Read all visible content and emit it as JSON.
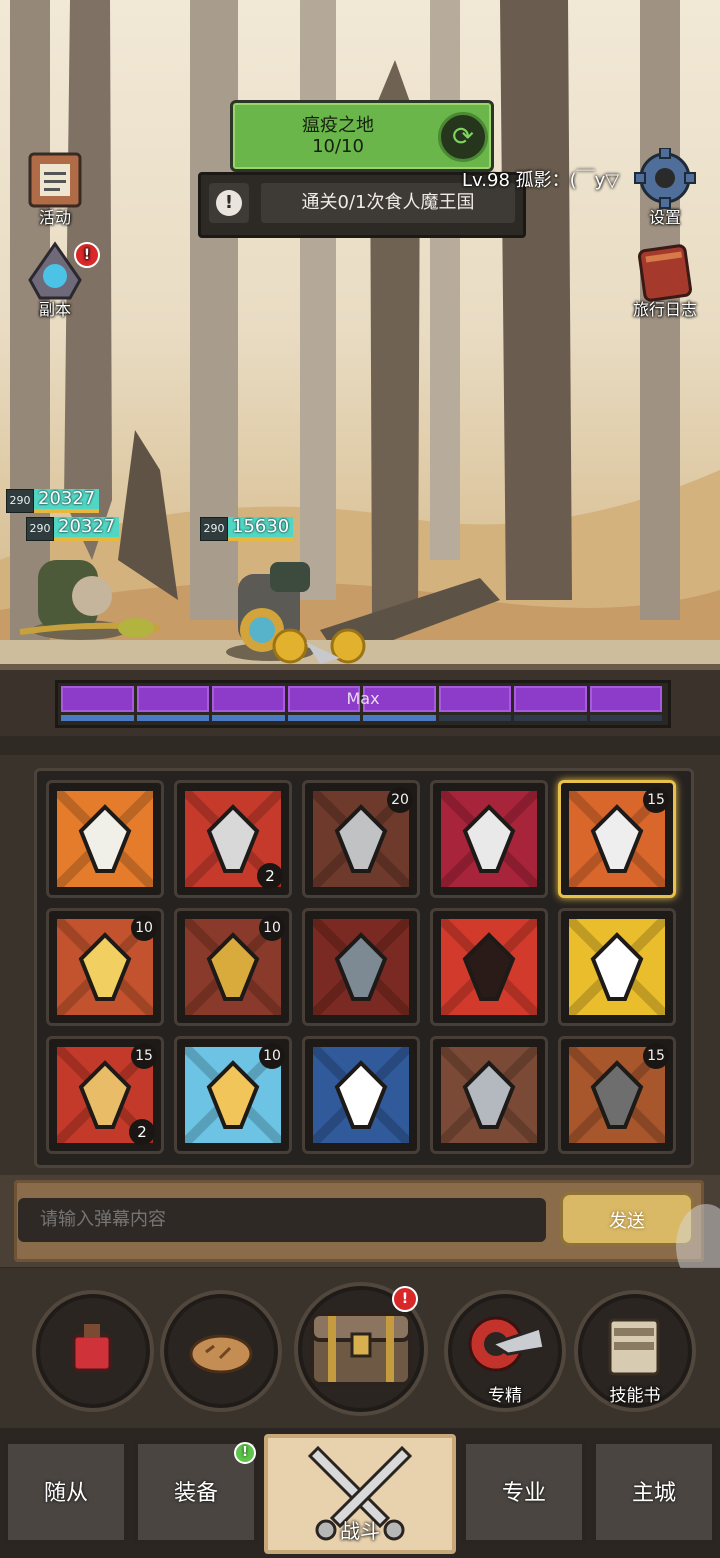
{
  "stage": {
    "name": "瘟疫之地",
    "progress": "10/10"
  },
  "quest": {
    "text": "通关0/1次食人魔王国"
  },
  "player": {
    "info": "Lv.98 孤影：(￣y▽"
  },
  "left_menu": [
    {
      "label": "活动",
      "icon": "event-scroll-icon",
      "alert": false
    },
    {
      "label": "副本",
      "icon": "dungeon-portal-icon",
      "alert": true,
      "alert_mark": "!"
    }
  ],
  "right_menu": [
    {
      "label": "设置",
      "icon": "gear-icon"
    },
    {
      "label": "旅行日志",
      "icon": "journal-icon"
    }
  ],
  "units": [
    {
      "level": "290",
      "hp": "20327"
    },
    {
      "level": "290",
      "hp": "20327"
    },
    {
      "level": "290",
      "hp": "15630"
    }
  ],
  "rage_bar": {
    "label": "Max",
    "segments": 8,
    "fill": 1.0
  },
  "skills": [
    {
      "icon": "white-shield-skill-icon",
      "badge": "",
      "count": ""
    },
    {
      "icon": "blade-slash-skill-icon",
      "badge": "",
      "count": "2"
    },
    {
      "icon": "warrior-helm-skill-icon",
      "badge": "20",
      "count": ""
    },
    {
      "icon": "heavy-cleave-skill-icon",
      "badge": "",
      "count": ""
    },
    {
      "icon": "sword-thrust-skill-icon",
      "badge": "15",
      "count": ""
    },
    {
      "icon": "shatter-armor-skill-icon",
      "badge": "10",
      "count": ""
    },
    {
      "icon": "gold-shield-skill-icon",
      "badge": "10",
      "count": ""
    },
    {
      "icon": "crossed-blade-skill-icon",
      "badge": "",
      "count": ""
    },
    {
      "icon": "war-mask-skill-icon",
      "badge": "",
      "count": ""
    },
    {
      "icon": "trident-burst-skill-icon",
      "badge": "",
      "count": ""
    },
    {
      "icon": "fracture-skill-icon",
      "badge": "15",
      "count": "2"
    },
    {
      "icon": "spinning-blades-skill-icon",
      "badge": "10",
      "count": ""
    },
    {
      "icon": "blank-card-skill-icon",
      "badge": "",
      "count": ""
    },
    {
      "icon": "dwarf-king-skill-icon",
      "badge": "",
      "count": ""
    },
    {
      "icon": "sentinel-statue-skill-icon",
      "badge": "15",
      "count": ""
    }
  ],
  "chat": {
    "placeholder": "请输入弹幕内容",
    "send_label": "发送"
  },
  "actions": [
    {
      "label": "",
      "icon": "red-potion-icon",
      "alert": false
    },
    {
      "label": "",
      "icon": "bread-icon",
      "alert": false
    },
    {
      "label": "",
      "icon": "treasure-chest-icon",
      "alert": true,
      "alert_mark": "!"
    },
    {
      "label": "专精",
      "icon": "mastery-axe-icon",
      "alert": false
    },
    {
      "label": "技能书",
      "icon": "skill-book-icon",
      "alert": false
    }
  ],
  "tabs": [
    {
      "label": "随从",
      "active": false,
      "alert": false
    },
    {
      "label": "装备",
      "active": false,
      "alert": true,
      "alert_mark": "!"
    },
    {
      "label": "战斗",
      "active": true,
      "alert": false
    },
    {
      "label": "专业",
      "active": false,
      "alert": false
    },
    {
      "label": "主城",
      "active": false,
      "alert": false
    }
  ],
  "colors": {
    "stage_green": "#6ab64a",
    "rage_purple": "#8d3bc9",
    "hp_cyan": "#52d6c4",
    "alert_red": "#d8282a",
    "alert_green": "#5dc54a",
    "send_gold": "#d9b866"
  }
}
